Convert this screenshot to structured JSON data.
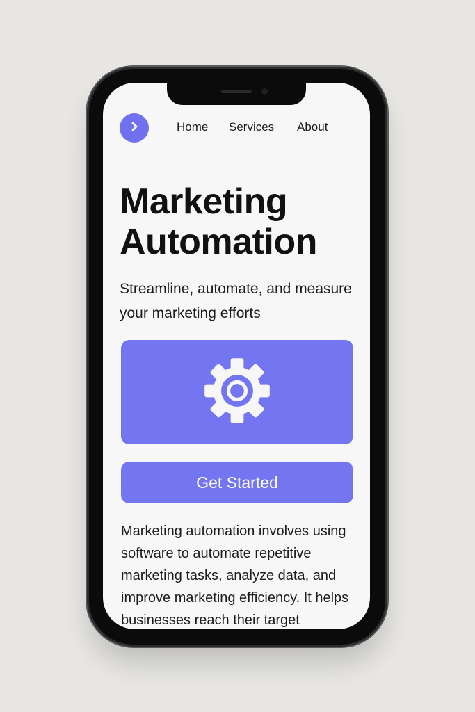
{
  "nav": {
    "logo_icon": "chevron-right-icon",
    "links": [
      "Home",
      "Services",
      "About"
    ]
  },
  "hero": {
    "title_line1": "Marketing",
    "title_line2": "Automation",
    "subtitle": "Streamline, automate, and measure your marketing efforts",
    "card_icon": "gear-icon",
    "cta_label": "Get Started"
  },
  "body": {
    "paragraph": "Marketing automation involves using software to automate repetitive marketing tasks, analyze data, and improve marketing efficiency. It helps businesses reach their target"
  },
  "colors": {
    "accent": "#7475f1",
    "background": "#f7f7f8",
    "page_background": "#e8e7e4",
    "text": "#111111",
    "device_frame": "#0b0b0c"
  }
}
